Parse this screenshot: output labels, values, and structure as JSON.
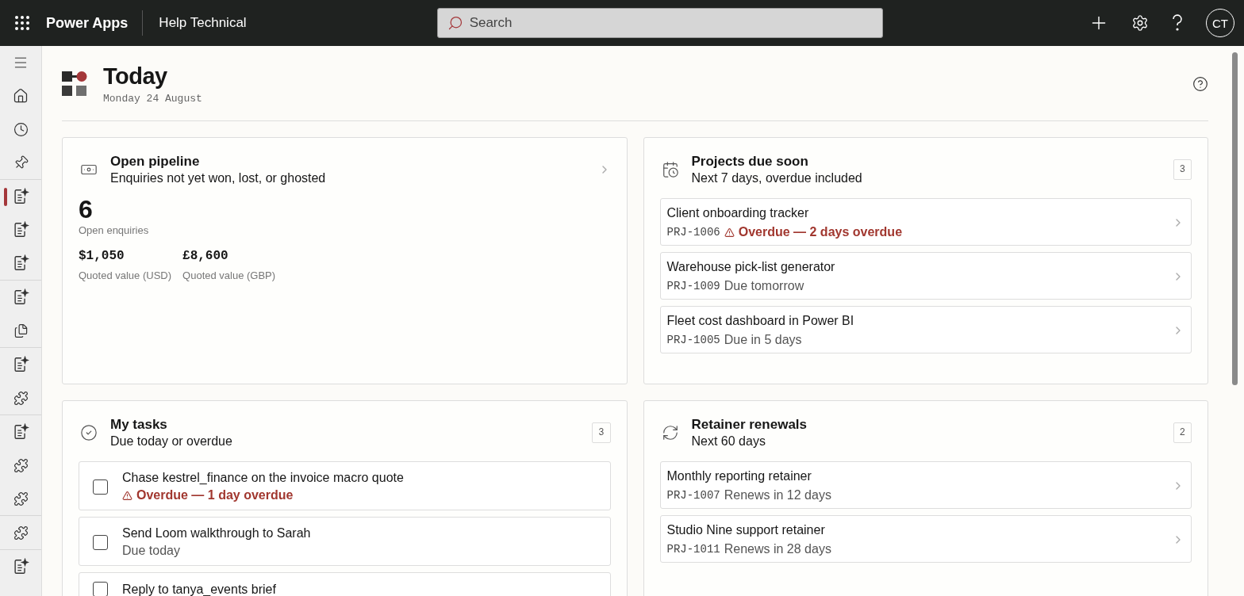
{
  "top_bar": {
    "app_name": "Power Apps",
    "environment": "Help Technical",
    "search": {
      "placeholder": "Search"
    },
    "avatar": "CT"
  },
  "sidebar": {
    "groups": [
      [
        {
          "kind": "menu",
          "selected": false
        },
        {
          "kind": "home",
          "selected": false
        },
        {
          "kind": "recent",
          "selected": false
        },
        {
          "kind": "pin",
          "selected": false
        }
      ],
      [
        {
          "kind": "app",
          "selected": true
        },
        {
          "kind": "app",
          "selected": false
        },
        {
          "kind": "app",
          "selected": false
        }
      ],
      [
        {
          "kind": "app",
          "selected": false
        },
        {
          "kind": "pages",
          "selected": false
        }
      ],
      [
        {
          "kind": "app",
          "selected": false
        },
        {
          "kind": "component",
          "selected": false
        }
      ],
      [
        {
          "kind": "app",
          "selected": false
        },
        {
          "kind": "component",
          "selected": false
        },
        {
          "kind": "component",
          "selected": false
        }
      ],
      [
        {
          "kind": "component",
          "selected": false
        }
      ],
      [
        {
          "kind": "app",
          "selected": false
        }
      ]
    ]
  },
  "page": {
    "title": "Today",
    "date": "Monday 24 August"
  },
  "cards": [
    {
      "kind": "metrics",
      "title": "Open pipeline",
      "subtitle": "Enquiries not yet won, lost, or ghosted",
      "big_value": "6",
      "big_label": "Open enquiries",
      "values": [
        {
          "value": "$1,050",
          "label": "Quoted value (USD)"
        },
        {
          "value": "£8,600",
          "label": "Quoted value (GBP)"
        }
      ]
    },
    {
      "kind": "list",
      "title": "Projects due soon",
      "subtitle": "Next 7 days, overdue included",
      "count": "3",
      "items": [
        {
          "title": "Client onboarding tracker",
          "code": "PRJ-1006",
          "status": "Overdue — 2 days overdue",
          "overdue": true
        },
        {
          "title": "Warehouse pick-list generator",
          "code": "PRJ-1009",
          "status": "Due tomorrow",
          "overdue": false
        },
        {
          "title": "Fleet cost dashboard in Power BI",
          "code": "PRJ-1005",
          "status": "Due in 5 days",
          "overdue": false
        }
      ]
    },
    {
      "kind": "tasks",
      "title": "My tasks",
      "subtitle": "Due today or overdue",
      "count": "3",
      "items": [
        {
          "title": "Chase kestrel_finance on the invoice macro quote",
          "status": "Overdue — 1 day overdue",
          "overdue": true,
          "checked": false
        },
        {
          "title": "Send Loom walkthrough to Sarah",
          "status": "Due today",
          "overdue": false,
          "checked": false
        },
        {
          "title": "Reply to tanya_events brief",
          "checked": false
        }
      ]
    },
    {
      "kind": "list",
      "title": "Retainer renewals",
      "subtitle": "Next 60 days",
      "count": "2",
      "items": [
        {
          "title": "Monthly reporting retainer",
          "code": "PRJ-1007",
          "status": "Renews in 12 days",
          "overdue": false
        },
        {
          "title": "Studio Nine support retainer",
          "code": "PRJ-1011",
          "status": "Renews in 28 days",
          "overdue": false
        }
      ]
    }
  ]
}
